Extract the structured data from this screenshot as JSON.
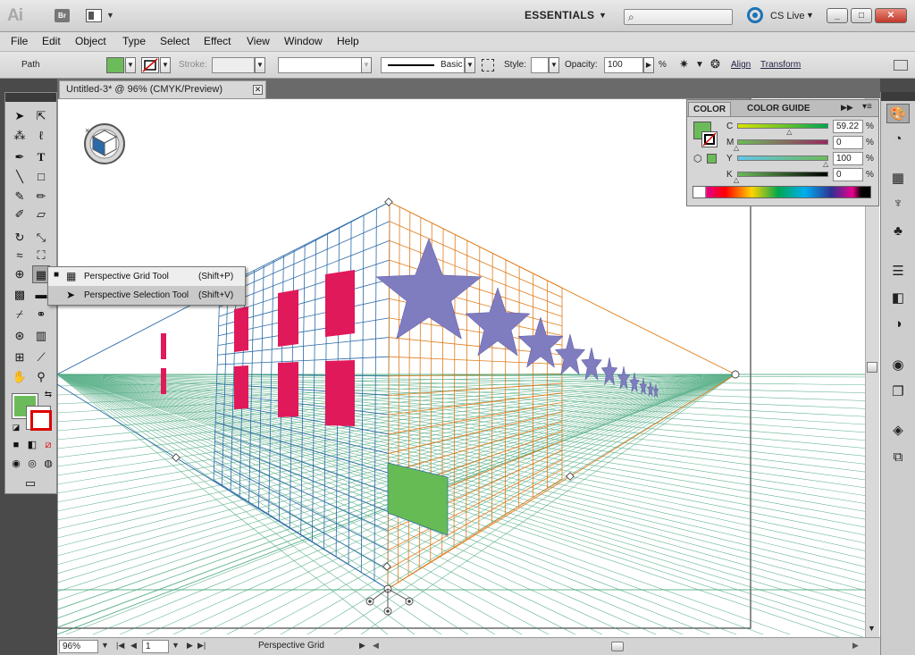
{
  "app": {
    "logo": "Ai",
    "bridge_label": "Br",
    "workspace": "ESSENTIALS",
    "cslive": "CS Live",
    "window_buttons": [
      "_",
      "□",
      "✕"
    ]
  },
  "menu": [
    "File",
    "Edit",
    "Object",
    "Type",
    "Select",
    "Effect",
    "View",
    "Window",
    "Help"
  ],
  "control": {
    "selection_type": "Path",
    "fill_color": "#6cbb5a",
    "stroke_label": "Stroke:",
    "stroke_profile": "Basic",
    "style_label": "Style:",
    "opacity_label": "Opacity:",
    "opacity_value": "100",
    "opacity_unit": "%",
    "align_link": "Align",
    "transform_link": "Transform"
  },
  "document": {
    "tab_title": "Untitled-3* @ 96% (CMYK/Preview)"
  },
  "flyout": {
    "items": [
      {
        "label": "Perspective Grid Tool",
        "shortcut": "(Shift+P)"
      },
      {
        "label": "Perspective Selection Tool",
        "shortcut": "(Shift+V)"
      }
    ]
  },
  "color_panel": {
    "tabs": [
      "COLOR",
      "COLOR GUIDE"
    ],
    "channels": [
      {
        "name": "C",
        "value": "59.22",
        "unit": "%",
        "level": 0.5922
      },
      {
        "name": "M",
        "value": "0",
        "unit": "%",
        "level": 0
      },
      {
        "name": "Y",
        "value": "100",
        "unit": "%",
        "level": 1
      },
      {
        "name": "K",
        "value": "0",
        "unit": "%",
        "level": 0
      }
    ],
    "fill_color": "#6cbb5a"
  },
  "status": {
    "zoom": "96%",
    "page": "1",
    "status_label": "Perspective Grid"
  },
  "colors": {
    "left_grid": "#2a6aa8",
    "right_grid": "#e07b1a",
    "ground_grid": "#2f9b6a",
    "windows": "#e0195a",
    "stars": "#7f7cc0",
    "green_shape": "#66bb55"
  }
}
